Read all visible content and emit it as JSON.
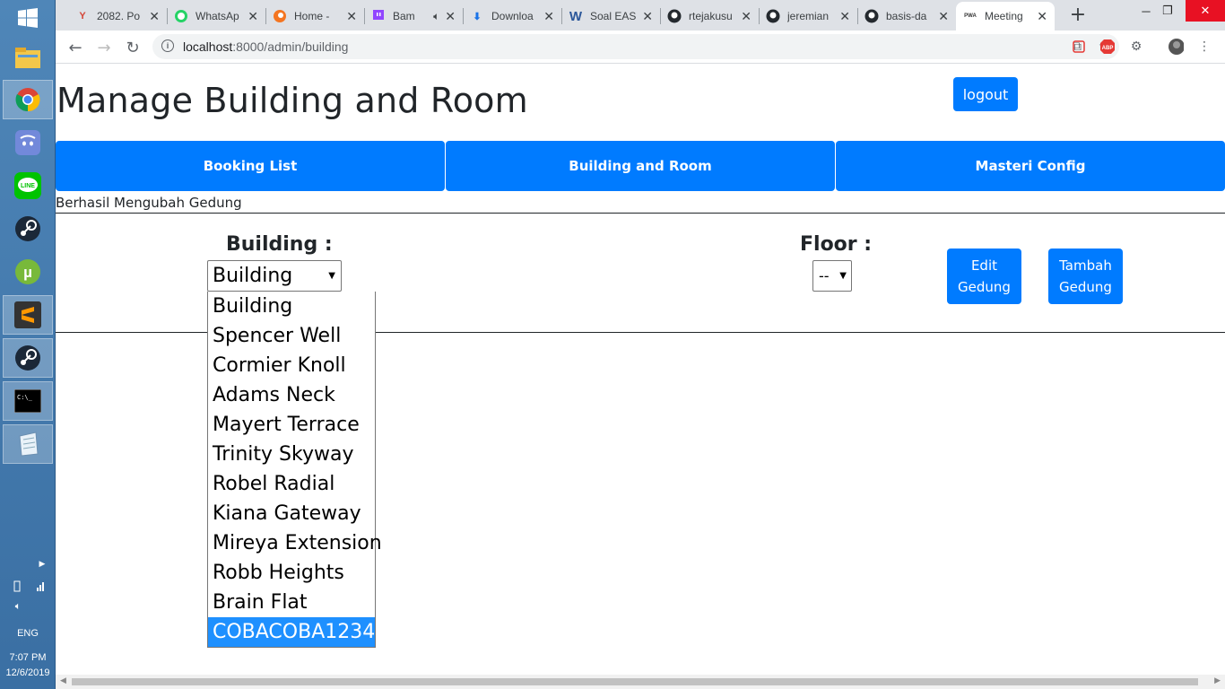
{
  "taskbar": {
    "apps": [
      "file-explorer",
      "chrome",
      "discord",
      "line",
      "steam",
      "utorrent",
      "sublime-text",
      "steam",
      "command-prompt",
      "notepad"
    ],
    "tray": {
      "lang": "ENG",
      "time": "7:07 PM",
      "date": "12/6/2019"
    }
  },
  "browser": {
    "tabs": [
      {
        "title": "2082. Po",
        "icon": "gmail-icon"
      },
      {
        "title": "WhatsAp",
        "icon": "whatsapp-icon"
      },
      {
        "title": "Home - ",
        "icon": "crunchyroll-icon"
      },
      {
        "title": "Bam",
        "icon": "twitch-icon"
      },
      {
        "title": "Downloa",
        "icon": "download-icon"
      },
      {
        "title": "Soal EAS",
        "icon": "word-icon"
      },
      {
        "title": "rtejakusu",
        "icon": "github-icon"
      },
      {
        "title": "jeremian",
        "icon": "github-icon"
      },
      {
        "title": "basis-da",
        "icon": "github-icon"
      },
      {
        "title": "Meeting",
        "icon": "pwa-icon"
      }
    ],
    "url_host": "localhost",
    "url_path": ":8000/admin/building"
  },
  "page": {
    "title": "Manage Building and Room",
    "logout": "logout",
    "nav": [
      "Booking List",
      "Building and Room",
      "Masteri Config"
    ],
    "flash": "Berhasil Mengubah Gedung",
    "building_label": "Building :",
    "building_value": "Building",
    "floor_label": "Floor :",
    "floor_value": "--",
    "edit_button": [
      "Edit",
      "Gedung"
    ],
    "add_button": [
      "Tambah",
      "Gedung"
    ],
    "building_options": [
      "Building",
      "Spencer Well",
      "Cormier Knoll",
      "Adams Neck",
      "Mayert Terrace",
      "Trinity Skyway",
      "Robel Radial",
      "Kiana Gateway",
      "Mireya Extension",
      "Robb Heights",
      "Brain Flat",
      "COBACOBA1234"
    ],
    "selected_option_index": 11
  },
  "colors": {
    "primary": "#007bff",
    "highlight": "#1e90ff",
    "taskbar": "#4a80b2"
  }
}
